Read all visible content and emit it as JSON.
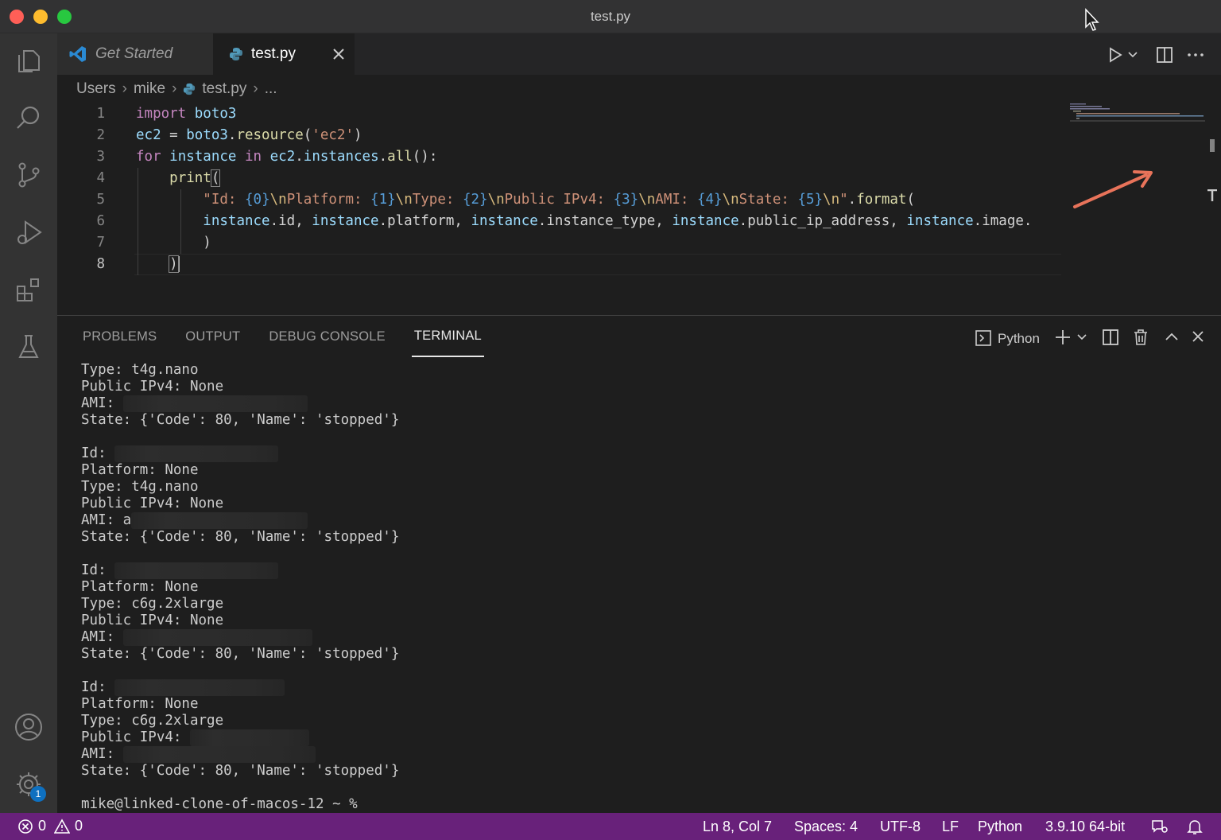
{
  "window": {
    "title": "test.py"
  },
  "tabs": [
    {
      "label": "Get Started"
    },
    {
      "label": "test.py"
    }
  ],
  "breadcrumb": {
    "parts": [
      "Users",
      "mike",
      "test.py",
      "..."
    ]
  },
  "editor": {
    "line_numbers": [
      "1",
      "2",
      "3",
      "4",
      "5",
      "6",
      "7",
      "8"
    ],
    "line1": {
      "t1": "import",
      "t2": "boto3"
    },
    "line2": {
      "t1": "ec2",
      "t2": " = ",
      "t3": "boto3",
      "t4": ".",
      "t5": "resource",
      "t6": "(",
      "t7": "'ec2'",
      "t8": ")"
    },
    "line3": {
      "t1": "for",
      "t2": "instance",
      "t3": "in",
      "t4": "ec2",
      "t5": ".",
      "t6": "instances",
      "t7": ".",
      "t8": "all",
      "t9": "():"
    },
    "line4": {
      "t1": "print",
      "t2": "("
    },
    "line5": {
      "q": "\"",
      "a": "Id: ",
      "p0": "{0}",
      "e0": "\\n",
      "b": "Platform: ",
      "p1": "{1}",
      "e1": "\\n",
      "c": "Type: ",
      "p2": "{2}",
      "e2": "\\n",
      "d": "Public IPv4: ",
      "p3": "{3}",
      "e3": "\\n",
      "f": "AMI: ",
      "p4": "{4}",
      "e4": "\\n",
      "g": "State: ",
      "p5": "{5}",
      "e5": "\\n",
      "q2": "\"",
      "dot": ".",
      "fmt": "format",
      "par": "("
    },
    "line6": {
      "i1": "instance",
      "a1": ".id, ",
      "i2": "instance",
      "a2": ".platform, ",
      "i3": "instance",
      "a3": ".instance_type, ",
      "i4": "instance",
      "a4": ".public_ip_address, ",
      "i5": "instance",
      "a5": ".image."
    },
    "line7": {
      "t1": ")"
    },
    "line8": {
      "t1": ")"
    }
  },
  "panel": {
    "tabs": [
      "PROBLEMS",
      "OUTPUT",
      "DEBUG CONSOLE",
      "TERMINAL"
    ],
    "active_tab": "TERMINAL",
    "terminal_name": "Python"
  },
  "terminal": {
    "lines": [
      "Type: t4g.nano",
      "Public IPv4: None",
      "AMI: ",
      "State: {'Code': 80, 'Name': 'stopped'}",
      "",
      "Id: ",
      "Platform: None",
      "Type: t4g.nano",
      "Public IPv4: None",
      "AMI: a",
      "State: {'Code': 80, 'Name': 'stopped'}",
      "",
      "Id: ",
      "Platform: None",
      "Type: c6g.2xlarge",
      "Public IPv4: None",
      "AMI: ",
      "State: {'Code': 80, 'Name': 'stopped'}",
      "",
      "Id: ",
      "Platform: None",
      "Type: c6g.2xlarge",
      "Public IPv4: ",
      "AMI: ",
      "State: {'Code': 80, 'Name': 'stopped'}",
      "",
      "mike@linked-clone-of-macos-12 ~ %"
    ]
  },
  "statusbar": {
    "errors": "0",
    "warnings": "0",
    "position": "Ln 8, Col 7",
    "spaces": "Spaces: 4",
    "encoding": "UTF-8",
    "eol": "LF",
    "language": "Python",
    "interpreter": "3.9.10 64-bit"
  },
  "activity": {
    "settings_badge": "1"
  },
  "colors": {
    "statusbar": "#68217a",
    "annotation_arrow": "#e8735a",
    "badge": "#0e70c0"
  }
}
